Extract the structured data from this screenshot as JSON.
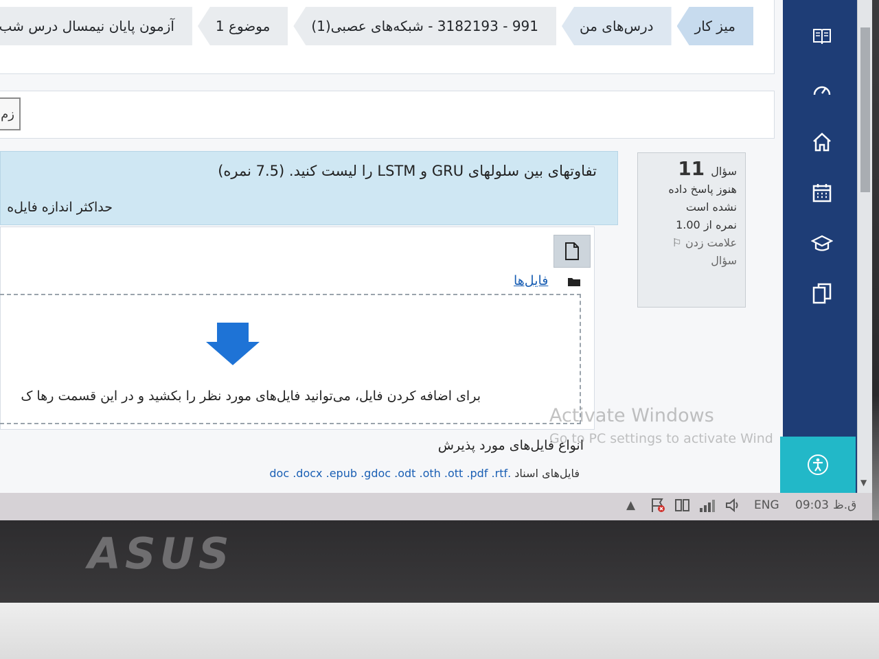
{
  "breadcrumb": {
    "items": [
      "میز کار",
      "درس‌های من",
      "991 - 3182193 - شبکه‌های عصبی(1)",
      "موضوع 1",
      "آزمون پایان نیمسال درس شب"
    ]
  },
  "timer_button_label": "زم",
  "question_info": {
    "label": "سؤال",
    "number": "11",
    "status": "هنوز پاسخ داده نشده است",
    "grade": "نمره از 1.00",
    "flag_label": "علامت زدن سؤال"
  },
  "question": {
    "text": "تفاوتهای بین سلولهای  GRU  و  LSTM  را لیست کنید. (7.5 نمره)",
    "max_size_label": "حداکثر اندازه فایل‌ه"
  },
  "file_picker": {
    "files_link": "فایل‌ها",
    "drop_text": "برای اضافه کردن فایل، می‌توانید فایل‌های مورد نظر را بکشید و در این قسمت رها ک",
    "accepted_title": "انواع فایل‌های مورد پذیرش",
    "accepted_label": "فایل‌های اسناد",
    "accepted_exts": ".doc .docx .epub .gdoc .odt .oth .ott .pdf .rtf"
  },
  "sidenav": {
    "icons": [
      "book-icon",
      "dashboard-icon",
      "home-icon",
      "calendar-icon",
      "graduation-cap-icon",
      "copy-icon"
    ]
  },
  "watermark": {
    "line1": "Activate Windows",
    "line2": "Go to PC settings to activate Wind"
  },
  "taskbar": {
    "lang": "ENG",
    "time": "09:03",
    "time_suffix": "ق.ظ"
  },
  "laptop_brand": "ASUS",
  "colors": {
    "sidenav": "#1e3d76",
    "accessibility": "#22b8c8",
    "question_bg": "#cfe7f3",
    "link": "#1a5fb4",
    "arrow": "#1e73d6"
  }
}
